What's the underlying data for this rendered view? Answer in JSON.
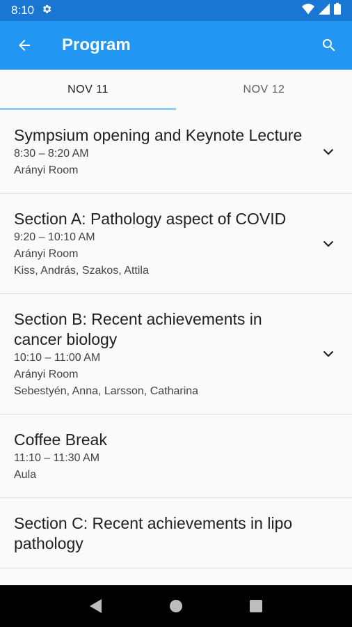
{
  "status": {
    "time": "8:10"
  },
  "app_bar": {
    "title": "Program"
  },
  "tabs": [
    {
      "label": "NOV 11",
      "active": true
    },
    {
      "label": "NOV 12",
      "active": false
    }
  ],
  "sessions": [
    {
      "title": "Sympsium opening and Keynote Lecture",
      "time": "8:30 – 8:20 AM",
      "room": "Arányi Room",
      "speakers": "",
      "expandable": true
    },
    {
      "title": "Section A: Pathology aspect of COVID",
      "time": "9:20 – 10:10 AM",
      "room": "Arányi Room",
      "speakers": "Kiss, András, Szakos, Attila",
      "expandable": true
    },
    {
      "title": "Section B: Recent achievements in cancer biology",
      "time": "10:10 – 11:00 AM",
      "room": "Arányi Room",
      "speakers": "Sebestyén, Anna, Larsson, Catharina",
      "expandable": true
    },
    {
      "title": "Coffee Break",
      "time": "11:10 – 11:30 AM",
      "room": "Aula",
      "speakers": "",
      "expandable": false
    },
    {
      "title": "Section C: Recent achievements in lipo pathology",
      "time": "",
      "room": "",
      "speakers": "",
      "expandable": false
    }
  ],
  "colors": {
    "status_bar": "#1976d2",
    "app_bar": "#2196f3",
    "tab_indicator": "#90caf9"
  },
  "icons": [
    "gear-icon",
    "wifi-icon",
    "signal-icon",
    "battery-icon",
    "back-arrow-icon",
    "search-icon",
    "chevron-down-icon",
    "nav-back-icon",
    "nav-home-icon",
    "nav-recents-icon"
  ]
}
